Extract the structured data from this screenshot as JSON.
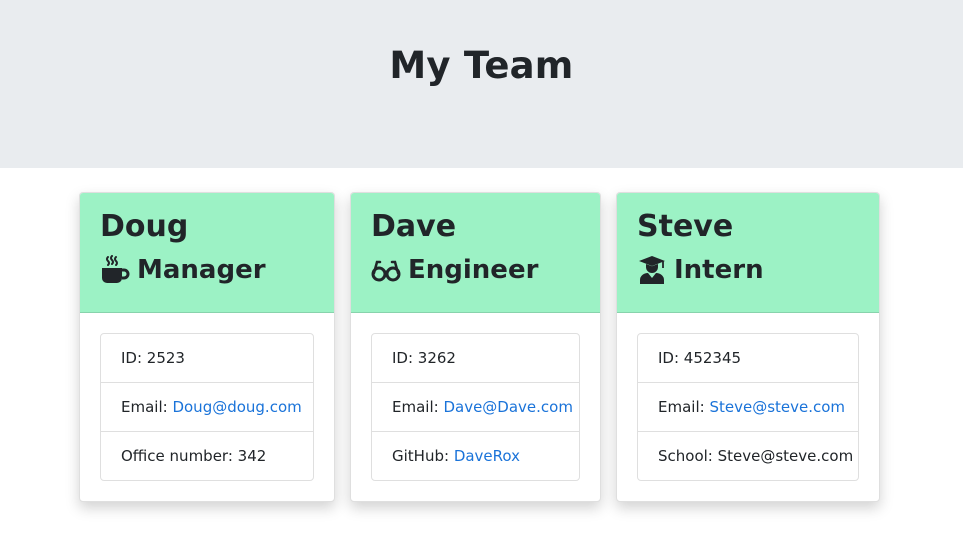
{
  "header": {
    "title": "My Team"
  },
  "members": [
    {
      "name": "Doug",
      "role": "Manager",
      "icon": "coffee-icon",
      "id_label": "ID: ",
      "id": "2523",
      "email_label": "Email: ",
      "email": "Doug@doug.com",
      "extra_label": "Office number: ",
      "extra": "342"
    },
    {
      "name": "Dave",
      "role": "Engineer",
      "icon": "glasses-icon",
      "id_label": "ID: ",
      "id": "3262",
      "email_label": "Email: ",
      "email": "Dave@Dave.com",
      "extra_label": "GitHub: ",
      "extra": "DaveRox"
    },
    {
      "name": "Steve",
      "role": "Intern",
      "icon": "graduate-icon",
      "id_label": "ID: ",
      "id": "452345",
      "email_label": "Email: ",
      "email": "Steve@steve.com",
      "extra_label": "School: ",
      "extra": "Steve@steve.com"
    }
  ],
  "colors": {
    "header_bg": "#e9ecef",
    "card_header_bg": "#9cf2c5",
    "link": "#1a73d9"
  }
}
